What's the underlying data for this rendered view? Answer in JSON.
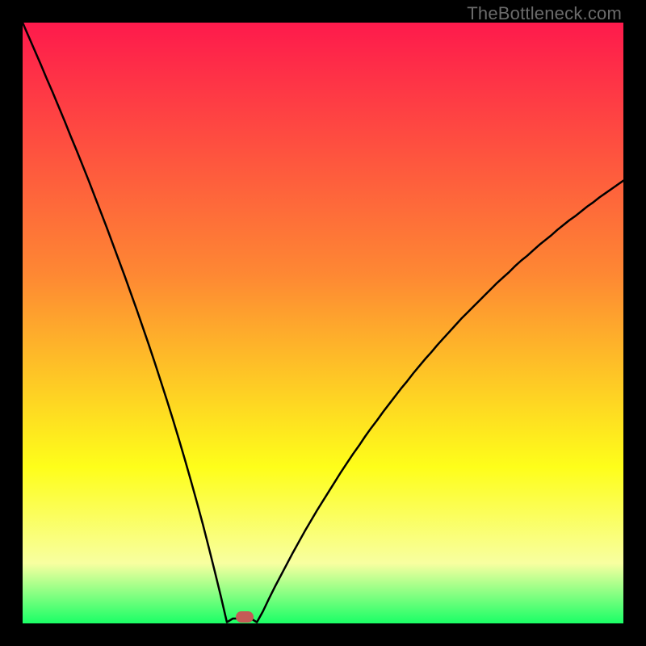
{
  "watermark": "TheBottleneck.com",
  "colors": {
    "gradient_top": "#fe1a4c",
    "gradient_mid1": "#fe8833",
    "gradient_mid2": "#fefe1a",
    "gradient_low": "#f8ffa0",
    "gradient_bottom": "#1aff66",
    "curve": "#000000",
    "marker": "#c55a56",
    "frame": "#000000"
  },
  "chart_data": {
    "type": "line",
    "title": "",
    "xlabel": "",
    "ylabel": "",
    "xlim": [
      0,
      100
    ],
    "ylim": [
      0,
      100
    ],
    "grid": false,
    "legend": false,
    "annotations": [
      "TheBottleneck.com"
    ],
    "x": [
      0,
      1,
      2,
      3,
      4,
      5,
      6,
      7,
      8,
      9,
      10,
      11,
      12,
      13,
      14,
      15,
      16,
      17,
      18,
      19,
      20,
      21,
      22,
      23,
      24,
      25,
      26,
      27,
      28,
      29,
      30,
      31,
      32,
      33,
      34,
      35,
      36,
      37,
      38,
      39,
      40,
      41,
      42,
      43,
      44,
      45,
      46,
      47,
      48,
      49,
      50,
      51,
      52,
      53,
      54,
      55,
      56,
      57,
      58,
      59,
      60,
      61,
      62,
      63,
      64,
      65,
      66,
      67,
      68,
      69,
      70,
      71,
      72,
      73,
      74,
      75,
      76,
      77,
      78,
      79,
      80,
      81,
      82,
      83,
      84,
      85,
      86,
      87,
      88,
      89,
      90,
      91,
      92,
      93,
      94,
      95,
      96,
      97,
      98,
      99,
      100
    ],
    "values": [
      100,
      97.7,
      95.4,
      93.1,
      90.7,
      88.4,
      86.0,
      83.6,
      81.1,
      78.7,
      76.2,
      73.7,
      71.1,
      68.5,
      65.9,
      63.2,
      60.5,
      57.8,
      55.0,
      52.2,
      49.3,
      46.4,
      43.4,
      40.3,
      37.2,
      34.0,
      30.7,
      27.3,
      23.8,
      20.2,
      16.5,
      12.6,
      8.6,
      4.5,
      0.2,
      0.0,
      0.0,
      0.0,
      0.0,
      0.2,
      2.0,
      4.1,
      6.1,
      8.0,
      9.9,
      11.8,
      13.6,
      15.4,
      17.1,
      18.8,
      20.4,
      22.0,
      23.6,
      25.2,
      26.7,
      28.2,
      29.6,
      31.1,
      32.5,
      33.8,
      35.2,
      36.5,
      37.8,
      39.1,
      40.3,
      41.6,
      42.8,
      44.0,
      45.1,
      46.3,
      47.4,
      48.5,
      49.6,
      50.7,
      51.7,
      52.7,
      53.7,
      54.7,
      55.7,
      56.7,
      57.6,
      58.5,
      59.5,
      60.4,
      61.2,
      62.1,
      63.0,
      63.8,
      64.6,
      65.5,
      66.3,
      67.1,
      67.8,
      68.6,
      69.4,
      70.1,
      70.9,
      71.6,
      72.3,
      73.0,
      73.7
    ],
    "marker": {
      "x": 37,
      "y": 0
    }
  }
}
